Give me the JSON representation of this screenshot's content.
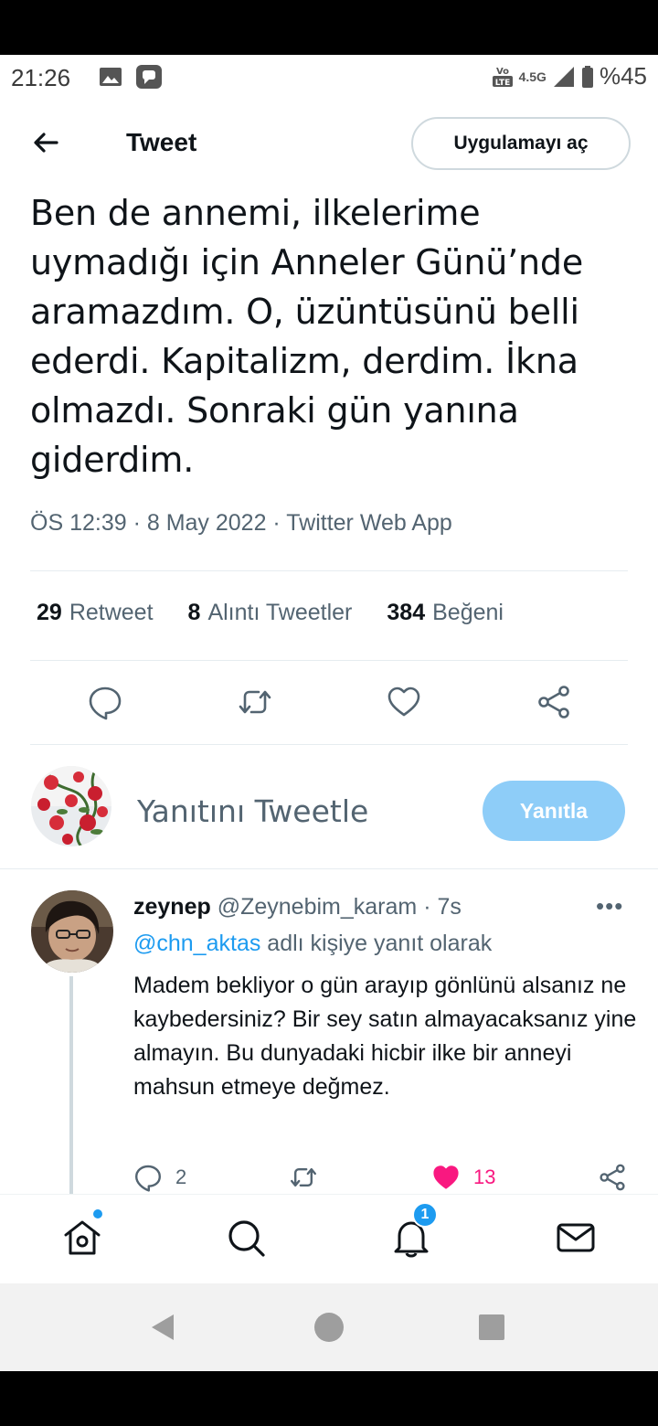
{
  "status_bar": {
    "time": "21:26",
    "network": "4.5G",
    "battery": "%45"
  },
  "header": {
    "title": "Tweet",
    "open_app_label": "Uygulamayı aç"
  },
  "tweet": {
    "text": "Ben de annemi, ilkelerime uymadığı için Anneler Günü’nde aramazdım. O, üzüntüsünü belli ederdi. Kapitalizm, derdim. İkna olmazdı. Sonraki gün yanına giderdim.",
    "meta": "ÖS 12:39 · 8 May 2022 · Twitter Web App",
    "stats": {
      "retweets_count": "29",
      "retweets_label": "Retweet",
      "quotes_count": "8",
      "quotes_label": "Alıntı Tweetler",
      "likes_count": "384",
      "likes_label": "Beğeni"
    }
  },
  "composer": {
    "prompt": "Yanıtını Tweetle",
    "reply_button": "Yanıtla"
  },
  "reply": {
    "name": "zeynep",
    "handle": "@Zeynebim_karam",
    "time": "· 7s",
    "more": "•••",
    "mention": "@chn_aktas",
    "reply_to_suffix": "adlı kişiye yanıt olarak",
    "text": "Madem bekliyor o gün arayıp gönlünü alsanız ne kaybedersiniz? Bir sey satın almayacaksanız yine almayın. Bu dunyadaki hicbir ilke bir anneyi mahsun etmeye değmez.",
    "reply_count": "2",
    "like_count": "13"
  },
  "bottom_nav": {
    "notification_badge": "1"
  },
  "colors": {
    "accent": "#1d9bf0",
    "reply_button_disabled": "#8ecdf8",
    "like": "#f91880",
    "text_secondary": "#536471"
  }
}
